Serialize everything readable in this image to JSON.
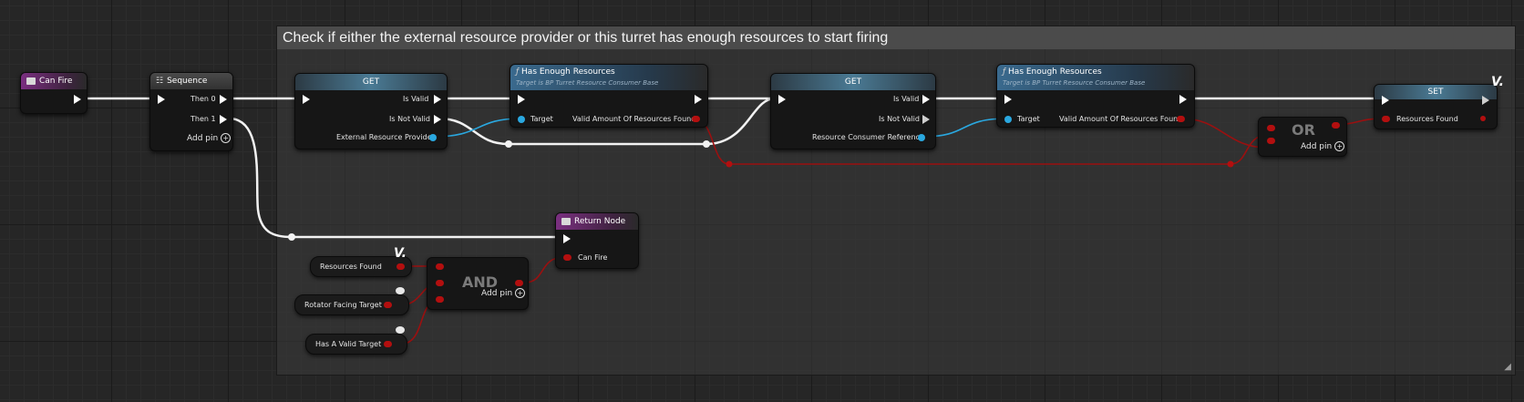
{
  "comment": {
    "title": "Check if either the external resource provider or this turret has enough resources to start firing"
  },
  "can_fire_node": {
    "title": "Can Fire"
  },
  "sequence_node": {
    "title": "Sequence",
    "then0": "Then 0",
    "then1": "Then 1",
    "add_pin": "Add pin"
  },
  "get1": {
    "title": "GET",
    "is_valid": "Is Valid",
    "is_not_valid": "Is Not Valid",
    "input": "External Resource Provider"
  },
  "has1": {
    "title": "Has Enough Resources",
    "subtitle": "Target is BP Turret Resource Consumer Base",
    "target": "Target",
    "output": "Valid Amount Of Resources Found"
  },
  "get2": {
    "title": "GET",
    "is_valid": "Is Valid",
    "is_not_valid": "Is Not Valid",
    "input": "Resource Consumer Reference"
  },
  "has2": {
    "title": "Has Enough Resources",
    "subtitle": "Target is BP Turret Resource Consumer Base",
    "target": "Target",
    "output": "Valid Amount Of Resources Found"
  },
  "or_node": {
    "title": "OR",
    "add_pin": "Add pin"
  },
  "set_node": {
    "title": "SET",
    "pin": "Resources Found"
  },
  "return_node": {
    "title": "Return Node",
    "pin": "Can Fire"
  },
  "and_node": {
    "title": "AND",
    "add_pin": "Add pin"
  },
  "vars": {
    "resources_found": "Resources Found",
    "rotator_facing": "Rotator Facing Target",
    "has_valid": "Has A Valid Target"
  },
  "colors": {
    "exec": "#ffffff",
    "bool": "#b30f0f",
    "object": "#2aa8e0",
    "function_header": "#3a6a8e",
    "event_header": "#7a2f80"
  }
}
